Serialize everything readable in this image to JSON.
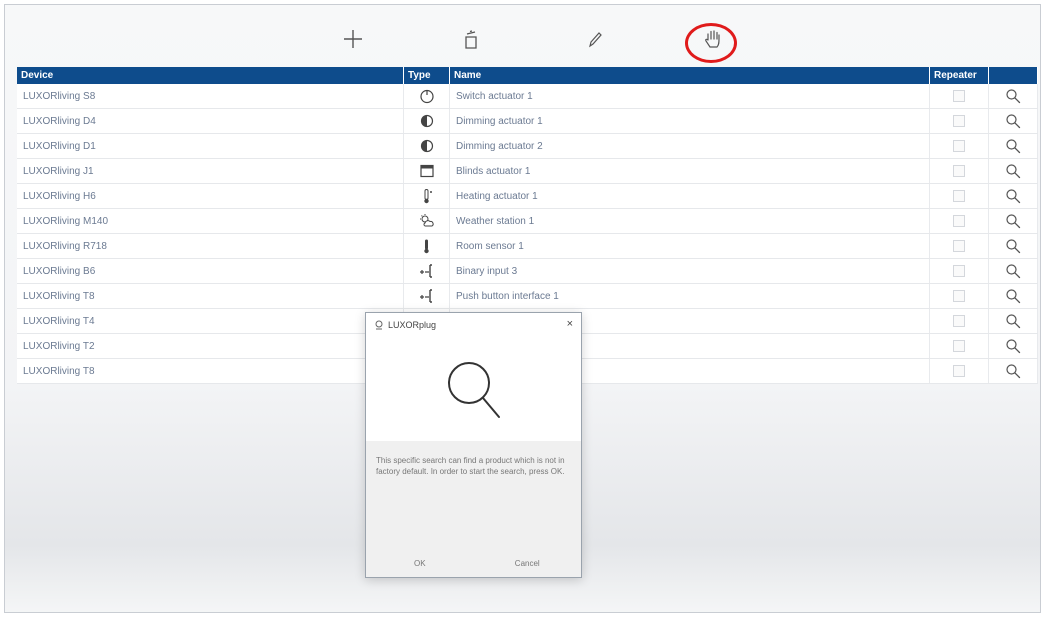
{
  "colors": {
    "header_bg": "#0e4c8c",
    "highlight_ring": "#e01b1b"
  },
  "toolbar": {
    "buttons": [
      {
        "name": "add-button",
        "icon": "plus-icon"
      },
      {
        "name": "delete-button",
        "icon": "trash-icon"
      },
      {
        "name": "edit-button",
        "icon": "pencil-icon"
      },
      {
        "name": "manual-mode-button",
        "icon": "hand-icon"
      }
    ]
  },
  "table": {
    "headers": {
      "device": "Device",
      "type": "Type",
      "name": "Name",
      "repeater": "Repeater",
      "search": ""
    },
    "rows": [
      {
        "device": "LUXORliving S8",
        "type_icon": "switch-actuator-icon",
        "name": "Switch actuator 1"
      },
      {
        "device": "LUXORliving D4",
        "type_icon": "dimming-actuator-icon",
        "name": "Dimming actuator 1"
      },
      {
        "device": "LUXORliving D1",
        "type_icon": "dimming-actuator-icon",
        "name": "Dimming actuator 2"
      },
      {
        "device": "LUXORliving J1",
        "type_icon": "blinds-actuator-icon",
        "name": "Blinds actuator 1"
      },
      {
        "device": "LUXORliving H6",
        "type_icon": "heating-actuator-icon",
        "name": "Heating actuator 1"
      },
      {
        "device": "LUXORliving M140",
        "type_icon": "weather-station-icon",
        "name": "Weather station 1"
      },
      {
        "device": "LUXORliving R718",
        "type_icon": "room-sensor-icon",
        "name": "Room sensor 1"
      },
      {
        "device": "LUXORliving B6",
        "type_icon": "binary-input-icon",
        "name": "Binary input 3"
      },
      {
        "device": "LUXORliving T8",
        "type_icon": "binary-input-icon",
        "name": "Push button interface 1"
      },
      {
        "device": "LUXORliving T4",
        "type_icon": "",
        "name": ""
      },
      {
        "device": "LUXORliving T2",
        "type_icon": "",
        "name": ""
      },
      {
        "device": "LUXORliving T8",
        "type_icon": "",
        "name": ""
      }
    ]
  },
  "dialog": {
    "title": "LUXORplug",
    "close": "×",
    "message": "This specific search can find a product which is not in factory default. In order to start the search, press OK.",
    "ok_label": "OK",
    "cancel_label": "Cancel"
  }
}
